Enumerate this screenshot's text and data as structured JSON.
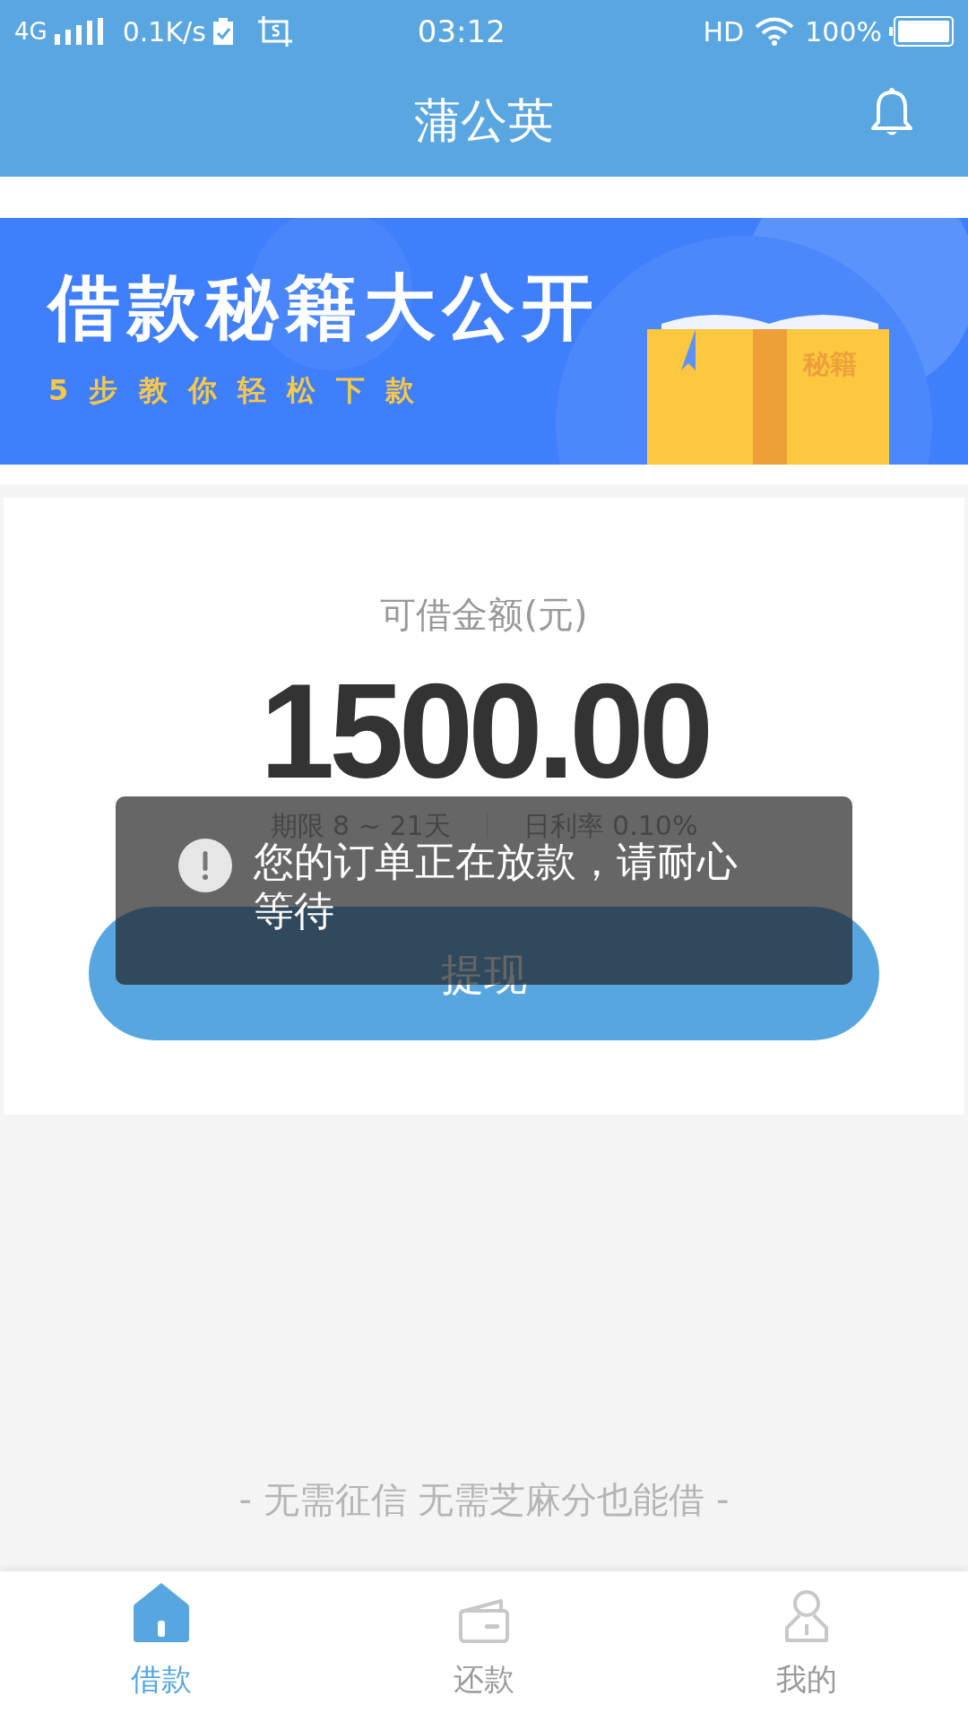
{
  "status_bar": {
    "network": "4G",
    "speed": "0.1K/s",
    "time": "03:12",
    "hd": "HD",
    "battery": "100%"
  },
  "header": {
    "title": "蒲公英"
  },
  "banner": {
    "headline": "借款秘籍大公开",
    "subline": "5 步 教 你 轻 松 下 款",
    "book_label": "秘籍"
  },
  "loan_card": {
    "label": "可借金额(元)",
    "amount": "1500.00",
    "term": "期限 8 ~ 21天",
    "rate": "日利率 0.10%",
    "button": "提现"
  },
  "toast": {
    "message": "您的订单正在放款，请耐心等待"
  },
  "slogan": "- 无需征信 无需芝麻分也能借 -",
  "tabs": [
    {
      "kind": "home",
      "label": "借款",
      "selected": true
    },
    {
      "kind": "wallet",
      "label": "还款",
      "selected": false
    },
    {
      "kind": "person",
      "label": "我的",
      "selected": false
    }
  ]
}
